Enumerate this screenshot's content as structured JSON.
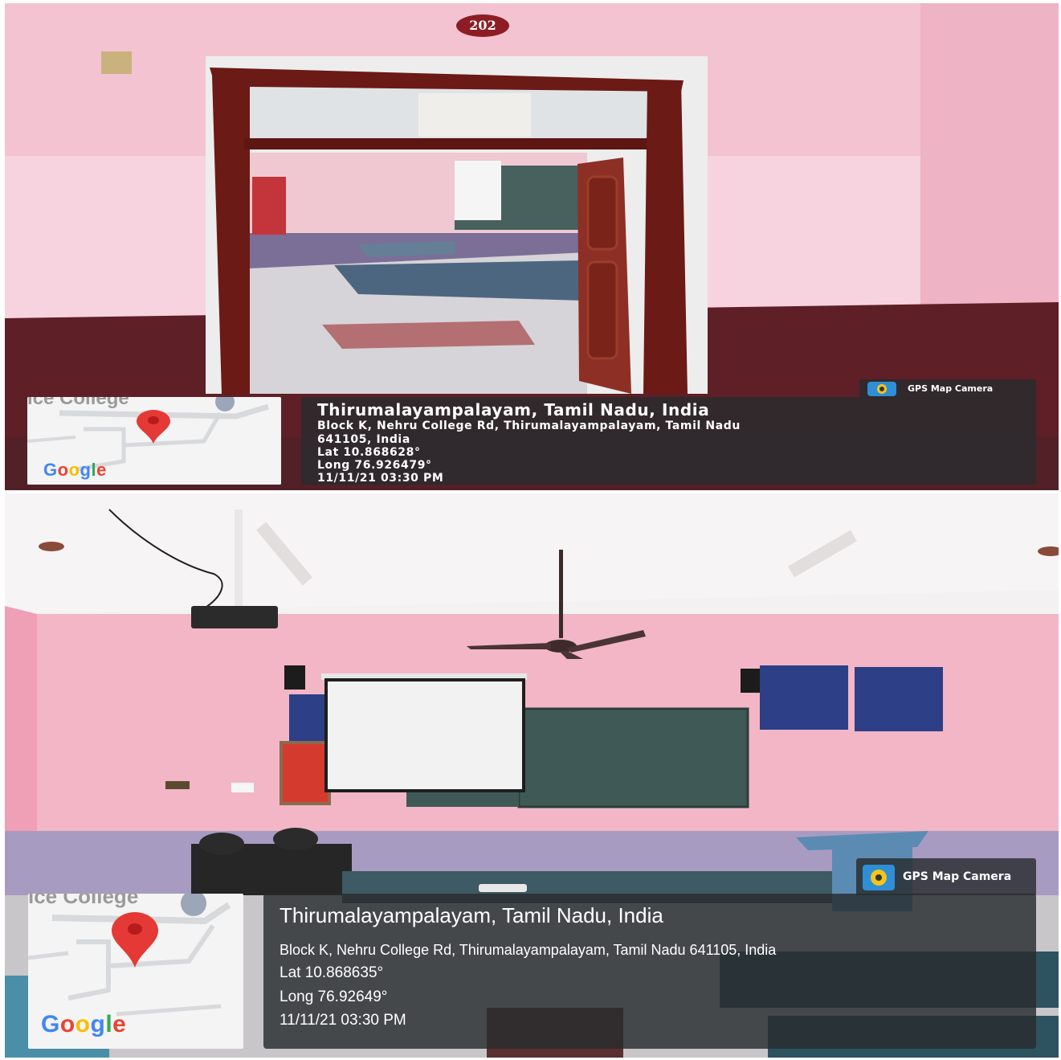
{
  "photos": [
    {
      "room_number": "202",
      "gps_badge": {
        "label": "GPS Map Camera",
        "icon": "camera-pin-icon"
      },
      "map": {
        "partial_label": "ice College",
        "logo": "Google",
        "pin": "map-pin-icon"
      },
      "location": {
        "title": "Thirumalayampalayam, Tamil Nadu, India",
        "address_line1": "Block K, Nehru College Rd, Thirumalayampalayam, Tamil Nadu",
        "address_line2": "641105, India",
        "lat": "Lat 10.868628°",
        "long": "Long 76.926479°",
        "datetime": "11/11/21 03:30 PM"
      }
    },
    {
      "gps_badge": {
        "label": "GPS Map Camera",
        "icon": "camera-pin-icon"
      },
      "map": {
        "partial_label": "ice College",
        "logo": "Google",
        "pin": "map-pin-icon"
      },
      "location": {
        "title": "Thirumalayampalayam, Tamil Nadu, India",
        "address": "Block K, Nehru College Rd, Thirumalayampalayam, Tamil Nadu 641105, India",
        "lat": "Lat 10.868635°",
        "long": "Long 76.92649°",
        "datetime": "11/11/21 03:30 PM"
      }
    }
  ],
  "google_colors": [
    "#4285F4",
    "#EA4335",
    "#FBBC05",
    "#4285F4",
    "#34A853",
    "#EA4335"
  ],
  "colors": {
    "wall_pink": "#f2b8c8",
    "wall_maroon": "#5e1f26",
    "door_frame": "#6b1a16",
    "panel_bg": "#2a2e30",
    "pin_red": "#e53935"
  }
}
